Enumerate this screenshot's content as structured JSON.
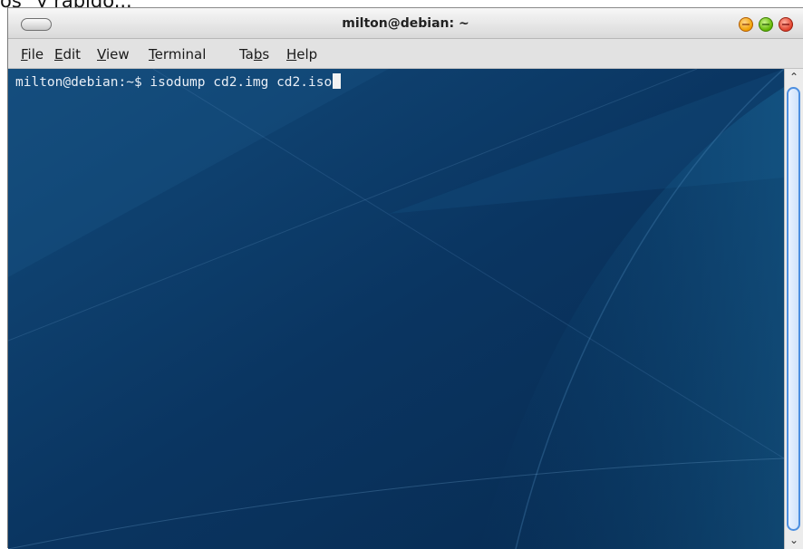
{
  "caption": "os\" y rápido...",
  "window": {
    "title": "milton@debian: ~"
  },
  "menu": {
    "items": [
      {
        "key": "F",
        "rest": "ile"
      },
      {
        "key": "E",
        "rest": "dit"
      },
      {
        "key": "V",
        "rest": "iew"
      },
      {
        "key": "T",
        "rest": "erminal"
      },
      {
        "pre": "Ta",
        "key": "b",
        "rest": "s"
      },
      {
        "key": "H",
        "rest": "elp"
      }
    ]
  },
  "terminal": {
    "prompt": "milton@debian:~$ ",
    "command": "isodump cd2.img cd2.iso"
  },
  "colors": {
    "terminal_bg": "#0b3660",
    "accent": "#4d8fe0"
  }
}
